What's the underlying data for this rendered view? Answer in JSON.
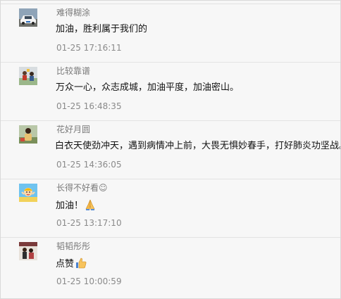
{
  "comments": [
    {
      "nickname": "难得糊涂",
      "text": "加油，胜利属于我们的",
      "time": "01-25 17:16:11",
      "avatar_icon": "car-avatar"
    },
    {
      "nickname": "比较靠谱",
      "text": "万众一心，众志成城，加油平度，加油密山。",
      "time": "01-25 16:48:35",
      "avatar_icon": "people-avatar"
    },
    {
      "nickname": "花好月圆",
      "text": "白衣天使劲冲天，遇到病情冲上前，大畏无惧妙春手，打好肺炎功坚战。",
      "time": "01-25 14:36:05",
      "avatar_icon": "person-avatar"
    },
    {
      "nickname": "长得不好看☺",
      "text": "加油！",
      "time": "01-25 13:17:10",
      "avatar_icon": "cartoon-avatar",
      "emoji": "pray-icon"
    },
    {
      "nickname": "韬韬彤彤",
      "text": "点赞",
      "time": "01-25 10:00:59",
      "avatar_icon": "family-avatar",
      "emoji": "thumbs-up-icon"
    }
  ]
}
